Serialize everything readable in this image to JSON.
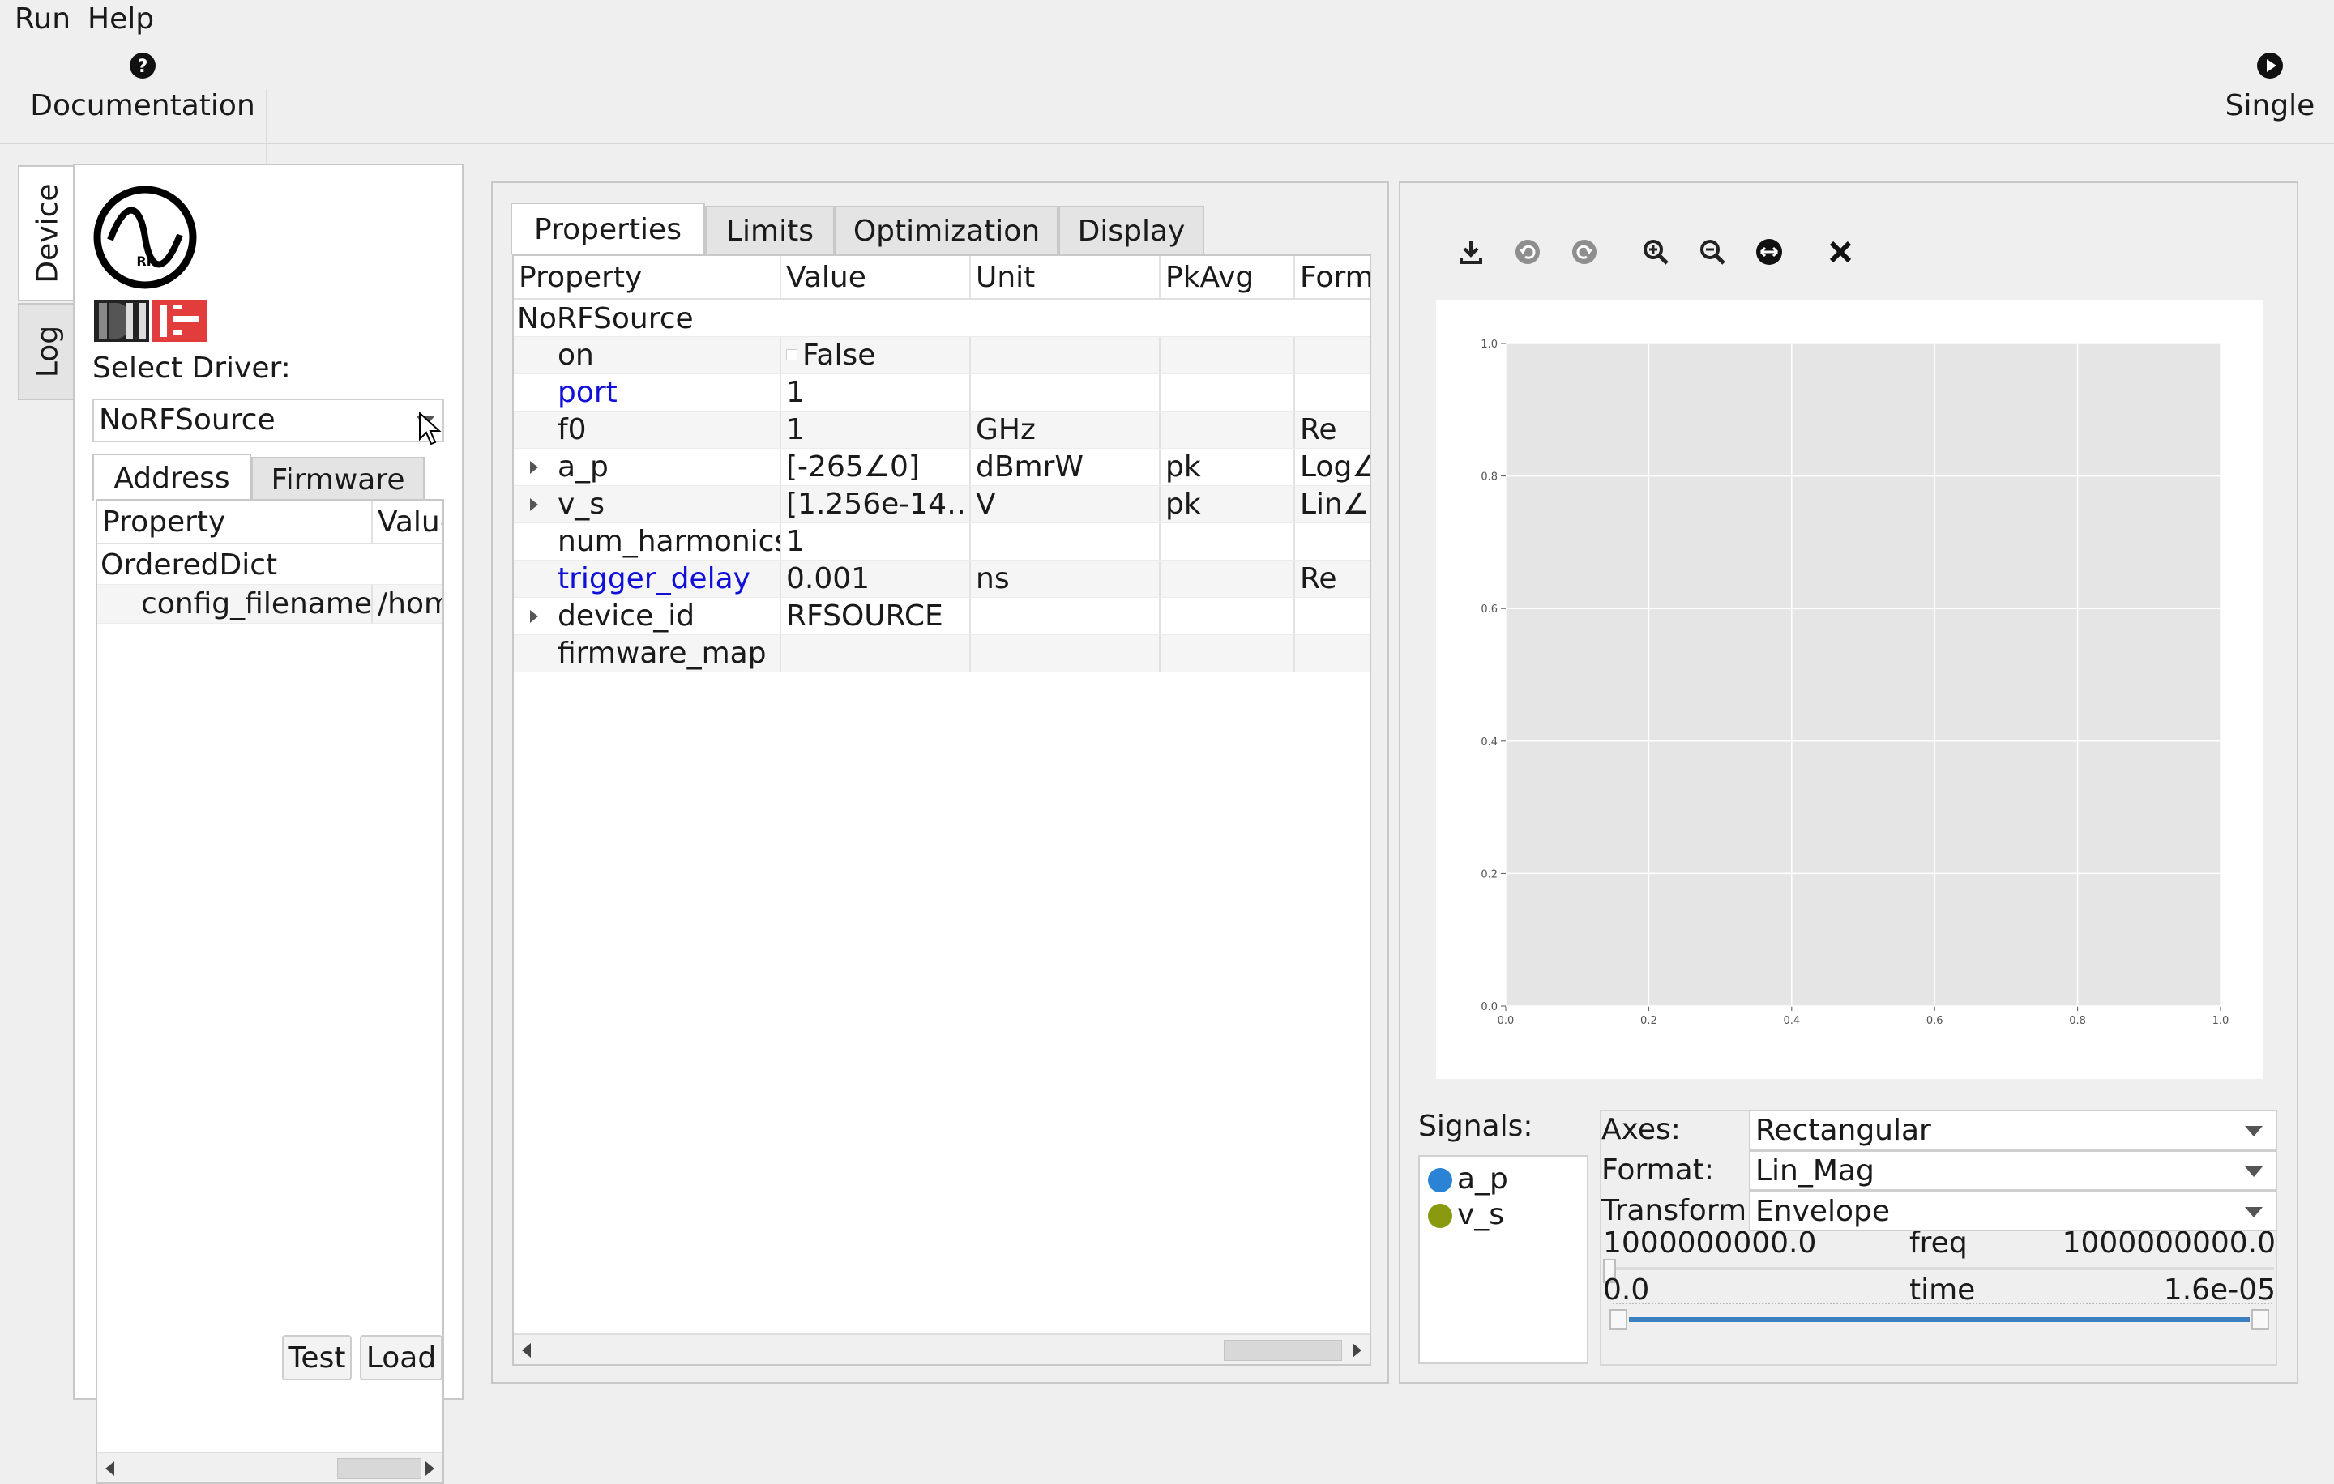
{
  "menu": {
    "items": [
      "Run",
      "Help"
    ]
  },
  "toolbar": {
    "documentation_label": "Documentation",
    "single_label": "Single"
  },
  "left": {
    "vtabs": {
      "device": "Device",
      "log": "Log"
    },
    "select_driver_label": "Select Driver:",
    "driver_value": "NoRFSource",
    "tabs": [
      "Address",
      "Firmware"
    ],
    "table": {
      "headers": [
        "Property",
        "Value"
      ],
      "rows": [
        {
          "prop": "OrderedDict",
          "value": ""
        },
        {
          "prop": "config_filename",
          "value": "/hom"
        }
      ]
    },
    "buttons": {
      "test": "Test",
      "load": "Load"
    }
  },
  "middle": {
    "tabs": [
      "Properties",
      "Limits",
      "Optimization",
      "Display"
    ],
    "headers": [
      "Property",
      "Value",
      "Unit",
      "PkAvg",
      "Form"
    ],
    "group": "NoRFSource",
    "rows": [
      {
        "prop": "on",
        "value": "False",
        "unit": "",
        "pkavg": "",
        "form": "",
        "link": false,
        "expandable": false,
        "checkbox": true
      },
      {
        "prop": "port",
        "value": "1",
        "unit": "",
        "pkavg": "",
        "form": "",
        "link": true,
        "expandable": false
      },
      {
        "prop": "f0",
        "value": "1",
        "unit": "GHz",
        "pkavg": "",
        "form": "Re",
        "link": false,
        "expandable": false
      },
      {
        "prop": "a_p",
        "value": "[-265∠0]",
        "unit": "dBmrW",
        "pkavg": "pk",
        "form": "Log∠",
        "link": false,
        "expandable": true
      },
      {
        "prop": "v_s",
        "value": "[1.256e-14…",
        "unit": "V",
        "pkavg": "pk",
        "form": "Lin∠",
        "link": false,
        "expandable": true
      },
      {
        "prop": "num_harmonics",
        "value": "1",
        "unit": "",
        "pkavg": "",
        "form": "",
        "link": false,
        "expandable": false
      },
      {
        "prop": "trigger_delay",
        "value": "0.001",
        "unit": "ns",
        "pkavg": "",
        "form": "Re",
        "link": true,
        "expandable": false
      },
      {
        "prop": "device_id",
        "value": "RFSOURCE",
        "unit": "",
        "pkavg": "",
        "form": "",
        "link": false,
        "expandable": true
      },
      {
        "prop": "firmware_map",
        "value": "",
        "unit": "",
        "pkavg": "",
        "form": "",
        "link": false,
        "expandable": false
      }
    ]
  },
  "right": {
    "plot_toolbar_icons": [
      "download-icon",
      "undo-icon",
      "redo-icon",
      "zoom-in-icon",
      "zoom-out-icon",
      "pan-icon",
      "close-icon"
    ],
    "chart_data": {
      "type": "line",
      "series": [],
      "xlim": [
        0.0,
        1.0
      ],
      "ylim": [
        0.0,
        1.0
      ],
      "xticks": [
        "0.0",
        "0.2",
        "0.4",
        "0.6",
        "0.8",
        "1.0"
      ],
      "yticks": [
        "0.0",
        "0.2",
        "0.4",
        "0.6",
        "0.8",
        "1.0"
      ],
      "grid": true,
      "plot_background": "#e5e5e5"
    },
    "signals_label": "Signals:",
    "signals": [
      {
        "name": "a_p",
        "color": "#2b83d6"
      },
      {
        "name": "v_s",
        "color": "#8a9a10"
      }
    ],
    "axes_label": "Axes:",
    "axes_value": "Rectangular",
    "format_label": "Format:",
    "format_value": "Lin_Mag",
    "transform_label": "Transform:",
    "transform_value": "Envelope",
    "freq_slider": {
      "min": "1000000000.0",
      "label": "freq",
      "max": "1000000000.0"
    },
    "time_slider": {
      "min": "0.0",
      "label": "time",
      "max": "1.6e-05"
    }
  }
}
